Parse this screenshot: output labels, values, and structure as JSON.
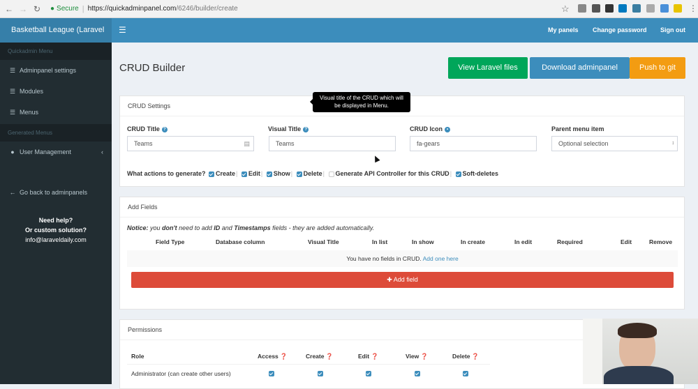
{
  "browser": {
    "secure_label": "Secure",
    "url_host": "https://quickadminpanel.com",
    "url_path": "/6246/builder/create"
  },
  "app": {
    "logo": "Basketball League (Laravel",
    "top_links": [
      "My panels",
      "Change password",
      "Sign out"
    ]
  },
  "sidebar": {
    "header1": "Quickadmin Menu",
    "items1": [
      {
        "label": "Adminpanel settings",
        "icon": "list-icon"
      },
      {
        "label": "Modules",
        "icon": "list-icon"
      },
      {
        "label": "Menus",
        "icon": "list-icon"
      }
    ],
    "header2": "Generated Menus",
    "items2": [
      {
        "label": "User Management",
        "icon": "users-icon"
      }
    ],
    "back": "Go back to adminpanels",
    "help1": "Need help?",
    "help2": "Or custom solution?",
    "email": "info@laraveldaily.com"
  },
  "page": {
    "title": "CRUD Builder",
    "buttons": [
      {
        "label": "View Laravel files",
        "color": "#00a65a"
      },
      {
        "label": "Download adminpanel",
        "color": "#3c8dbc"
      },
      {
        "label": "Push to git",
        "color": "#f39c12"
      }
    ]
  },
  "crud_settings": {
    "title": "CRUD Settings",
    "crud_title_label": "CRUD Title",
    "crud_title_value": "Teams",
    "visual_title_label": "Visual Title",
    "visual_title_value": "Teams",
    "crud_icon_label": "CRUD Icon",
    "crud_icon_value": "fa-gears",
    "parent_label": "Parent menu item",
    "parent_value": "Optional selection",
    "tooltip1": "Visual title of the CRUD which will",
    "tooltip2": "be displayed in Menu.",
    "actions_label": "What actions to generate?",
    "actions": [
      {
        "label": "Create",
        "checked": true
      },
      {
        "label": "Edit",
        "checked": true
      },
      {
        "label": "Show",
        "checked": true
      },
      {
        "label": "Delete",
        "checked": true
      },
      {
        "label": "Generate API Controller for this CRUD",
        "checked": false
      },
      {
        "label": "Soft-deletes",
        "checked": true
      }
    ]
  },
  "add_fields": {
    "title": "Add Fields",
    "notice_prefix": "Notice:",
    "notice_1": " you ",
    "notice_dont": "don't",
    "notice_2": " need to add ",
    "notice_id": "ID",
    "notice_3": " and ",
    "notice_ts": "Timestamps",
    "notice_4": " fields - they are added automatically.",
    "columns": [
      "Field Type",
      "Database column",
      "Visual Title",
      "In list",
      "In show",
      "In create",
      "In edit",
      "Required",
      "Edit",
      "Remove"
    ],
    "empty_text": "You have no fields in CRUD.",
    "empty_link": "Add one here",
    "add_button": "Add field"
  },
  "permissions": {
    "title": "Permissions",
    "columns": [
      "Role",
      "Access",
      "Create",
      "Edit",
      "View",
      "Delete"
    ],
    "rows": [
      {
        "role": "Administrator (can create other users)",
        "values": [
          true,
          true,
          true,
          true,
          true
        ]
      }
    ]
  }
}
